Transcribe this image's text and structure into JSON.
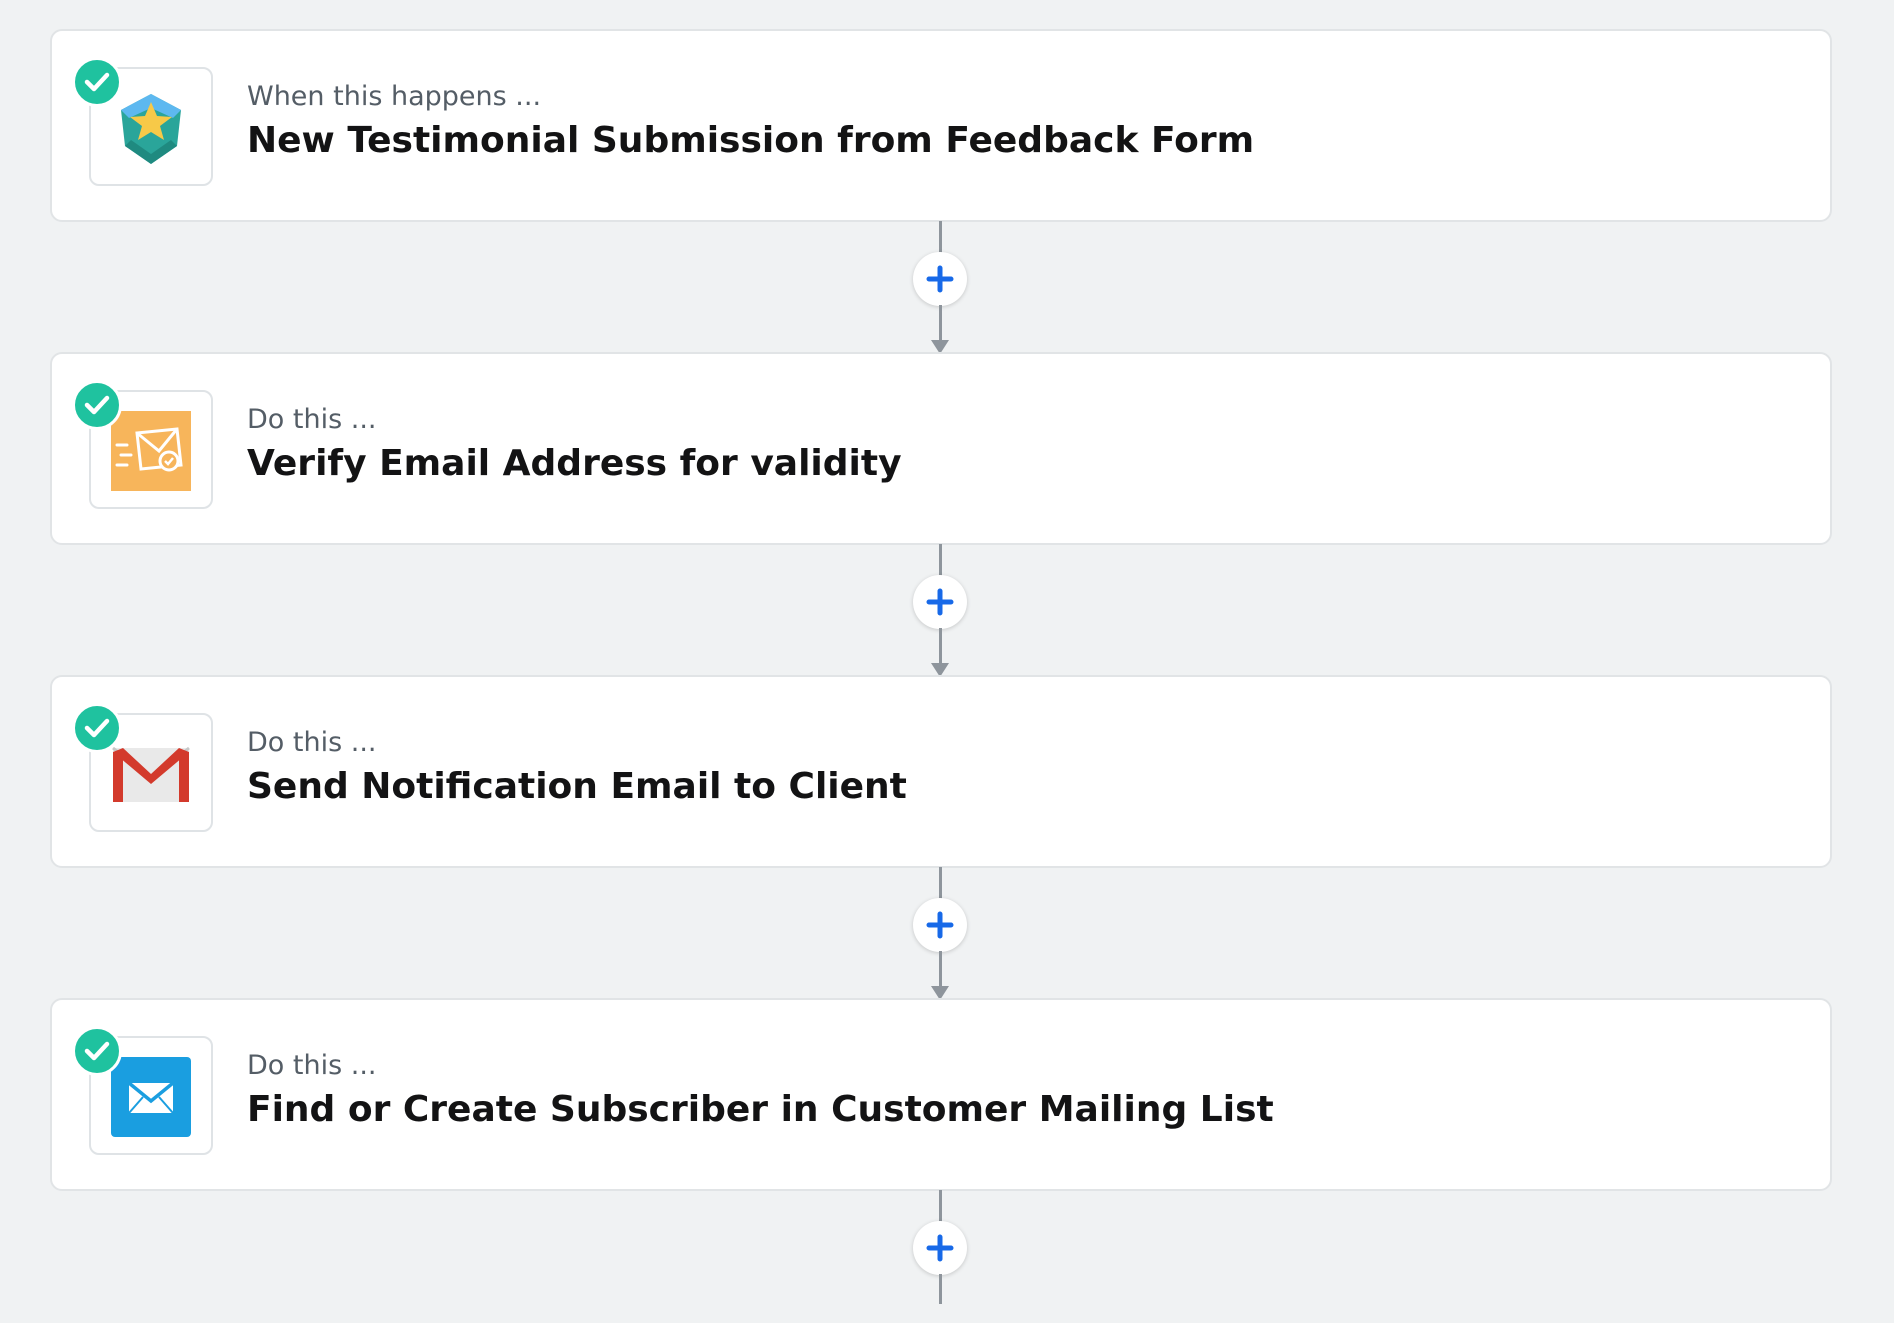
{
  "colors": {
    "background": "#f0f2f3",
    "check_badge": "#1fc29f",
    "add_plus": "#1769e8",
    "connector_line": "#8e959c"
  },
  "steps": [
    {
      "label": "When this happens ...",
      "title": "New Testimonial Submission from Feedback Form",
      "icon": "star-shield-icon",
      "status": "complete"
    },
    {
      "label": "Do this ...",
      "title": "Verify Email Address for validity",
      "icon": "email-verify-icon",
      "status": "complete"
    },
    {
      "label": "Do this ...",
      "title": "Send Notification Email to Client",
      "icon": "gmail-icon",
      "status": "complete"
    },
    {
      "label": "Do this ...",
      "title": "Find or Create Subscriber in Customer Mailing List",
      "icon": "mailing-list-envelope-icon",
      "status": "complete"
    }
  ],
  "add_step_icon": "plus-icon"
}
